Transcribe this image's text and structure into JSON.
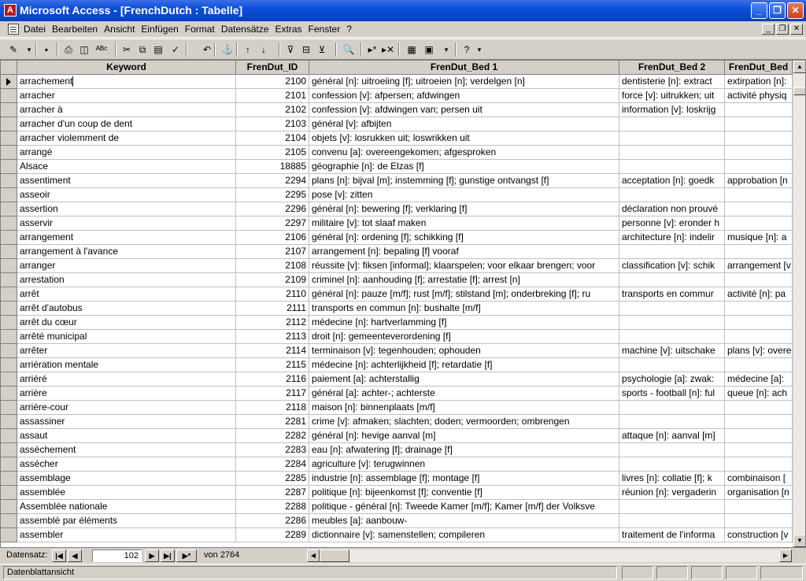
{
  "window": {
    "title": "Microsoft Access - [FrenchDutch : Tabelle]",
    "app_icon_letter": "A",
    "minimize_glyph": "_",
    "maximize_glyph": "❐",
    "close_glyph": "✕"
  },
  "menu": {
    "items": [
      "Datei",
      "Bearbeiten",
      "Ansicht",
      "Einfügen",
      "Format",
      "Datensätze",
      "Extras",
      "Fenster",
      "?"
    ],
    "mdi_min": "_",
    "mdi_restore": "❐",
    "mdi_close": "✕"
  },
  "toolbar": {
    "icons": [
      "design-view-icon",
      "dropdown-arrow-icon",
      "save-icon",
      "print-icon",
      "print-preview-icon",
      "spelling-icon",
      "cut-icon",
      "copy-icon",
      "paste-icon",
      "format-painter-icon",
      "undo-icon",
      "insert-hyperlink-icon",
      "sort-ascending-icon",
      "sort-descending-icon",
      "filter-by-selection-icon",
      "filter-by-form-icon",
      "apply-filter-icon",
      "find-icon",
      "new-record-icon",
      "delete-record-icon",
      "database-window-icon",
      "new-object-icon",
      "dropdown-arrow-icon",
      "help-icon",
      "dropdown-arrow-icon"
    ],
    "glyphs": [
      "✎",
      "▾",
      "▪",
      "⎙",
      "◫",
      "ᴬᴮᶜ",
      "✂",
      "⧉",
      "▤",
      "✓",
      "↶",
      "⚓",
      "↑",
      "↓",
      "⊽",
      "⊟",
      "⊻",
      "🔍",
      "▸*",
      "▸✕",
      "▦",
      "▣",
      "▾",
      "?",
      "▾"
    ]
  },
  "columns": {
    "keyword": "Keyword",
    "id": "FrenDut_ID",
    "bed1": "FrenDut_Bed 1",
    "bed2": "FrenDut_Bed 2",
    "bed3": "FrenDut_Bed"
  },
  "rows": [
    {
      "keyword": "arrachement",
      "id": "2100",
      "bed1": "général [n]: uitroeiing [f]; uitroeien [n]; verdelgen [n]",
      "bed2": "dentisterie [n]: extract",
      "bed3": "extirpation [n]:"
    },
    {
      "keyword": "arracher",
      "id": "2101",
      "bed1": "confession [v]: afpersen; afdwingen",
      "bed2": "force [v]: uitrukken; uit",
      "bed3": "activité physiq"
    },
    {
      "keyword": "arracher à",
      "id": "2102",
      "bed1": "confession [v]: afdwingen van; persen uit",
      "bed2": "information [v]: loskrijg",
      "bed3": ""
    },
    {
      "keyword": "arracher d'un coup de dent",
      "id": "2103",
      "bed1": "général [v]: afbijten",
      "bed2": "",
      "bed3": ""
    },
    {
      "keyword": "arracher violemment de",
      "id": "2104",
      "bed1": "objets [v]: losrukken uit; loswrikken uit",
      "bed2": "",
      "bed3": ""
    },
    {
      "keyword": "arrangé",
      "id": "2105",
      "bed1": "convenu [a]: overeengekomen; afgesproken",
      "bed2": "",
      "bed3": ""
    },
    {
      "keyword": "Alsace",
      "id": "18885",
      "bed1": "géographie [n]: de Elzas [f]",
      "bed2": "",
      "bed3": ""
    },
    {
      "keyword": "assentiment",
      "id": "2294",
      "bed1": "plans [n]: bijval [m]; instemming [f]; gunstige ontvangst [f]",
      "bed2": "acceptation [n]: goedk",
      "bed3": "approbation [n"
    },
    {
      "keyword": "asseoir",
      "id": "2295",
      "bed1": "pose [v]: zitten",
      "bed2": "",
      "bed3": ""
    },
    {
      "keyword": "assertion",
      "id": "2296",
      "bed1": "général [n]: bewering [f]; verklaring [f]",
      "bed2": "déclaration non prouvé",
      "bed3": ""
    },
    {
      "keyword": "asservir",
      "id": "2297",
      "bed1": "militaire [v]: tot slaaf maken",
      "bed2": "personne [v]: eronder h",
      "bed3": ""
    },
    {
      "keyword": "arrangement",
      "id": "2106",
      "bed1": "général [n]: ordening [f]; schikking [f]",
      "bed2": "architecture [n]: indelir",
      "bed3": "musique [n]: a"
    },
    {
      "keyword": "arrangement à l'avance",
      "id": "2107",
      "bed1": "arrangement [n]: bepaling [f] vooraf",
      "bed2": "",
      "bed3": ""
    },
    {
      "keyword": "arranger",
      "id": "2108",
      "bed1": "réussite [v]: fiksen [informal]; klaarspelen; voor elkaar brengen; voor",
      "bed2": "classification [v]: schik",
      "bed3": "arrangement [v"
    },
    {
      "keyword": "arrestation",
      "id": "2109",
      "bed1": "criminel [n]: aanhouding [f]; arrestatie [f]; arrest [n]",
      "bed2": "",
      "bed3": ""
    },
    {
      "keyword": "arrêt",
      "id": "2110",
      "bed1": "général [n]: pauze [m/f]; rust [m/f]; stilstand [m]; onderbreking [f]; ru",
      "bed2": "transports en commur",
      "bed3": "activité [n]: pa"
    },
    {
      "keyword": "arrêt d'autobus",
      "id": "2111",
      "bed1": "transports en commun [n]: bushalte [m/f]",
      "bed2": "",
      "bed3": ""
    },
    {
      "keyword": "arrêt du cœur",
      "id": "2112",
      "bed1": "médecine [n]: hartverlamming [f]",
      "bed2": "",
      "bed3": ""
    },
    {
      "keyword": "arrêté municipal",
      "id": "2113",
      "bed1": "droit [n]: gemeenteverordening [f]",
      "bed2": "",
      "bed3": ""
    },
    {
      "keyword": "arrêter",
      "id": "2114",
      "bed1": "terminaison [v]: tegenhouden; ophouden",
      "bed2": "machine [v]: uitschake",
      "bed3": "plans [v]: overe"
    },
    {
      "keyword": "arriération mentale",
      "id": "2115",
      "bed1": "médecine [n]: achterlijkheid [f]; retardatie [f]",
      "bed2": "",
      "bed3": ""
    },
    {
      "keyword": "arriéré",
      "id": "2116",
      "bed1": "paiement [a]: achterstallig",
      "bed2": "psychologie [a]: zwak:",
      "bed3": "médecine [a]:"
    },
    {
      "keyword": "arrière",
      "id": "2117",
      "bed1": "général [a]: achter-; achterste",
      "bed2": "sports - football [n]: ful",
      "bed3": "queue [n]: ach"
    },
    {
      "keyword": "arrière-cour",
      "id": "2118",
      "bed1": "maison [n]: binnenplaats [m/f]",
      "bed2": "",
      "bed3": ""
    },
    {
      "keyword": "assassiner",
      "id": "2281",
      "bed1": "crime [v]: afmaken; slachten; doden; vermoorden; ombrengen",
      "bed2": "",
      "bed3": ""
    },
    {
      "keyword": "assaut",
      "id": "2282",
      "bed1": "général [n]: hevige aanval [m]",
      "bed2": "attaque [n]: aanval [m]",
      "bed3": ""
    },
    {
      "keyword": "assèchement",
      "id": "2283",
      "bed1": "eau [n]: afwatering [f]; drainage [f]",
      "bed2": "",
      "bed3": ""
    },
    {
      "keyword": "assécher",
      "id": "2284",
      "bed1": "agriculture [v]: terugwinnen",
      "bed2": "",
      "bed3": ""
    },
    {
      "keyword": "assemblage",
      "id": "2285",
      "bed1": "industrie [n]: assemblage [f]; montage [f]",
      "bed2": "livres [n]: collatie [f]; k",
      "bed3": "combinaison ["
    },
    {
      "keyword": "assemblée",
      "id": "2287",
      "bed1": "politique [n]: bijeenkomst [f]; conventie [f]",
      "bed2": "réunion [n]: vergaderin",
      "bed3": "organisation [n"
    },
    {
      "keyword": "Assemblée nationale",
      "id": "2288",
      "bed1": "politique - général [n]: Tweede Kamer [m/f]; Kamer [m/f] der Volksve",
      "bed2": "",
      "bed3": ""
    },
    {
      "keyword": "assemblé par éléments",
      "id": "2286",
      "bed1": "meubles [a]: aanbouw-",
      "bed2": "",
      "bed3": ""
    },
    {
      "keyword": "assembler",
      "id": "2289",
      "bed1": "dictionnaire [v]: samenstellen; compileren",
      "bed2": "traitement de l'informa",
      "bed3": "construction [v"
    }
  ],
  "navigation": {
    "label": "Datensatz:",
    "current": "102",
    "of_label": "von",
    "total": "2764",
    "first_glyph": "|◀",
    "prev_glyph": "◀",
    "next_glyph": "▶",
    "last_glyph": "▶|",
    "new_glyph": "▶*"
  },
  "status": {
    "text": "Datenblattansicht"
  }
}
